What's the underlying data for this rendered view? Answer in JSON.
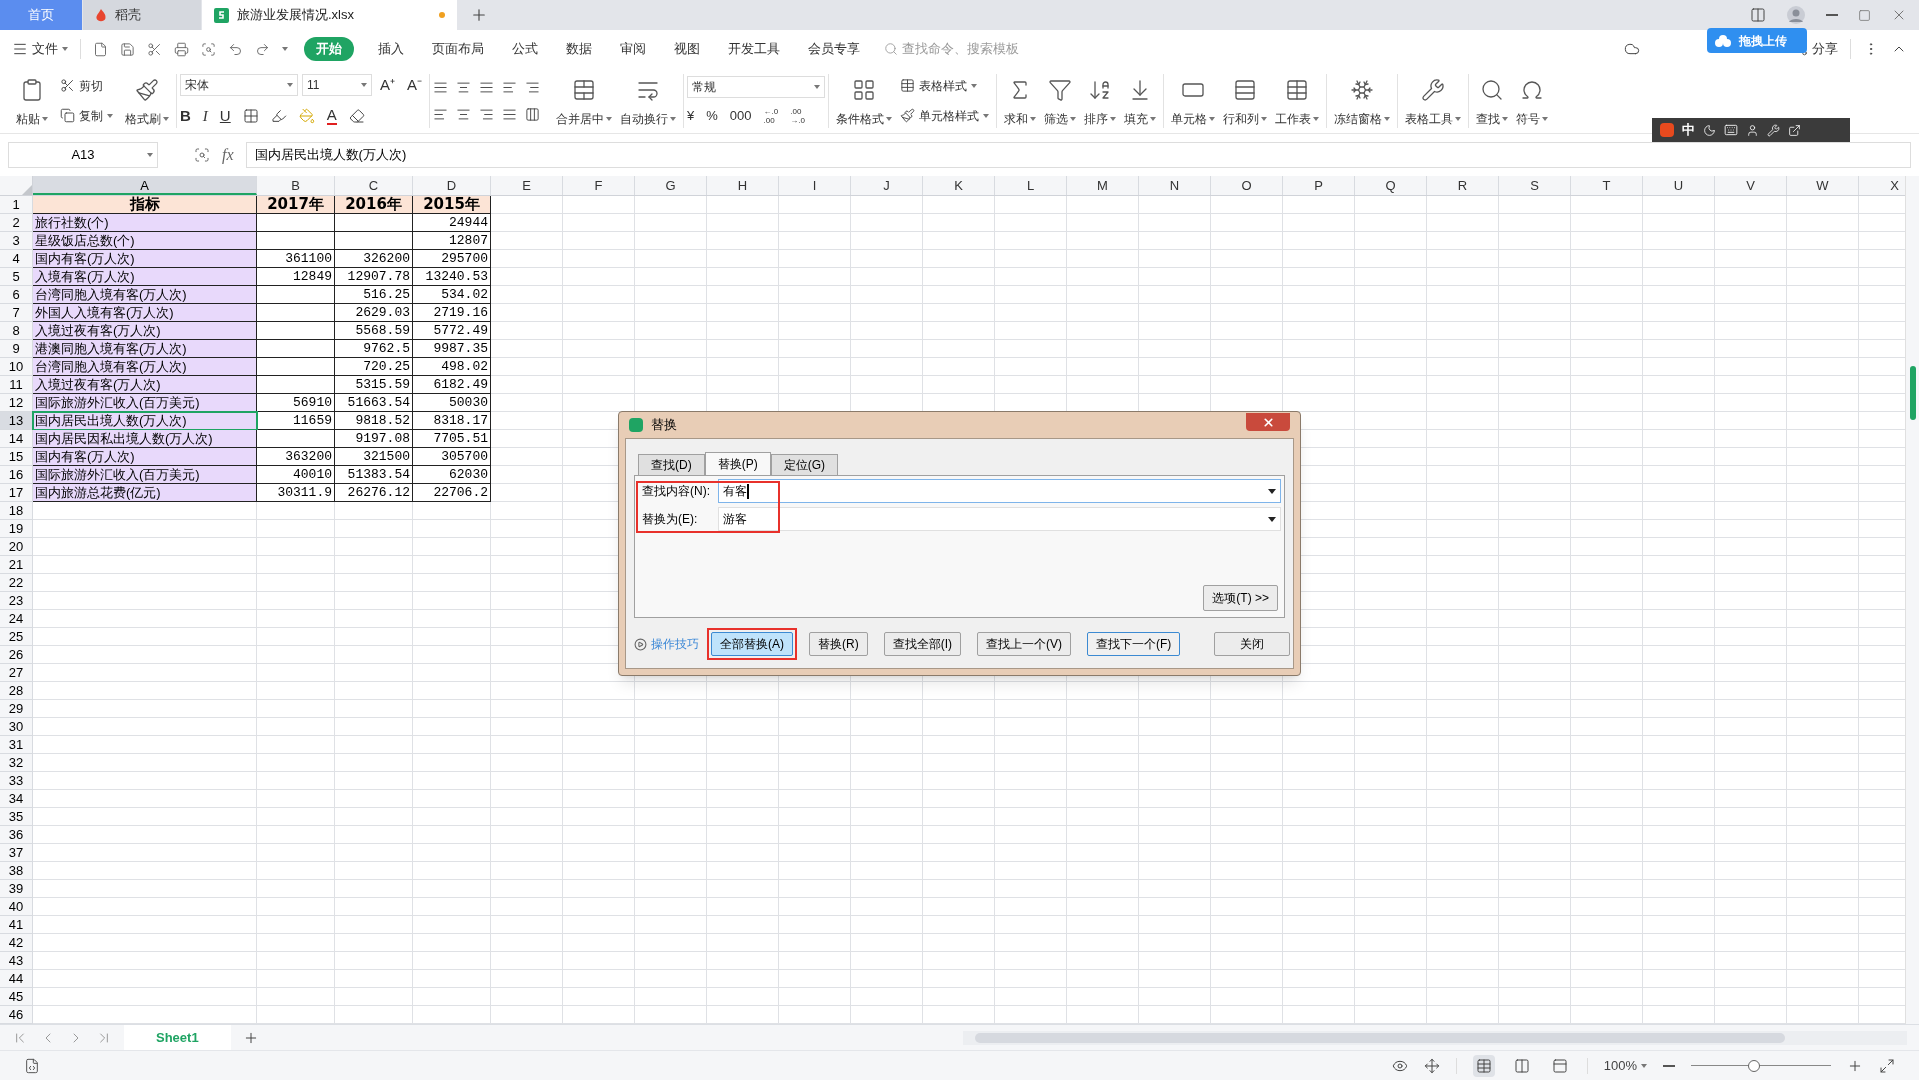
{
  "tabs": [
    {
      "label": "首页",
      "kind": "home",
      "selected": false,
      "unsaved": false
    },
    {
      "label": "稻壳",
      "kind": "docer",
      "selected": false,
      "unsaved": false
    },
    {
      "label": "旅游业发展情况.xlsx",
      "kind": "file",
      "selected": true,
      "unsaved": true
    }
  ],
  "menu": {
    "file": "文件",
    "items": [
      {
        "label": "开始",
        "selected": true
      },
      {
        "label": "插入",
        "selected": false
      },
      {
        "label": "页面布局",
        "selected": false
      },
      {
        "label": "公式",
        "selected": false
      },
      {
        "label": "数据",
        "selected": false
      },
      {
        "label": "审阅",
        "selected": false
      },
      {
        "label": "视图",
        "selected": false
      },
      {
        "label": "开发工具",
        "selected": false
      },
      {
        "label": "会员专享",
        "selected": false
      }
    ],
    "search": {
      "placeholder": "查找命令、搜索模板"
    },
    "share": "分享",
    "upload_popup": "拖拽上传"
  },
  "ribbon": {
    "clipboard": {
      "paste": "粘贴",
      "cut": "剪切",
      "copy": "复制",
      "format_painter": "格式刷"
    },
    "font": {
      "name": "宋体",
      "size": "11",
      "grow": "A⁺",
      "shrink": "A⁻",
      "styles": [
        "B",
        "I",
        "U"
      ],
      "font_color": "A"
    },
    "alignment": {
      "merge": "合并居中",
      "wrap": "自动换行"
    },
    "number": {
      "format": "常规",
      "symbols": [
        "¥",
        "%",
        "000"
      ],
      "decimals": [
        [
          "←.0",
          ".00"
        ],
        [
          ".00",
          "→.0"
        ]
      ]
    },
    "styles": {
      "conditional": "条件格式",
      "table_style": "表格样式",
      "cell_style": "单元格样式"
    },
    "tools": [
      "求和",
      "筛选",
      "排序",
      "填充",
      "单元格",
      "行和列",
      "工作表",
      "冻结窗格",
      "表格工具",
      "查找",
      "符号"
    ]
  },
  "ime": {
    "mode": "中"
  },
  "formula_bar": {
    "name_box": "A13",
    "fx": "fx",
    "formula": "国内居民出境人数(万人次)"
  },
  "sheet": {
    "columns": [
      {
        "label": "A",
        "selected": true
      },
      {
        "label": "B",
        "selected": false
      },
      {
        "label": "C",
        "selected": false
      },
      {
        "label": "D",
        "selected": false
      },
      {
        "label": "E",
        "selected": false
      },
      {
        "label": "F",
        "selected": false
      },
      {
        "label": "G",
        "selected": false
      },
      {
        "label": "H",
        "selected": false
      },
      {
        "label": "I",
        "selected": false
      },
      {
        "label": "J",
        "selected": false
      },
      {
        "label": "K",
        "selected": false
      },
      {
        "label": "L",
        "selected": false
      },
      {
        "label": "M",
        "selected": false
      },
      {
        "label": "N",
        "selected": false
      },
      {
        "label": "O",
        "selected": false
      },
      {
        "label": "P",
        "selected": false
      },
      {
        "label": "Q",
        "selected": false
      },
      {
        "label": "R",
        "selected": false
      },
      {
        "label": "S",
        "selected": false
      },
      {
        "label": "T",
        "selected": false
      },
      {
        "label": "U",
        "selected": false
      },
      {
        "label": "V",
        "selected": false
      },
      {
        "label": "W",
        "selected": false
      },
      {
        "label": "X",
        "selected": false
      }
    ],
    "rows": [
      {
        "number": "1",
        "kind": "header",
        "selected": false,
        "cells": [
          "指标",
          "2017年",
          "2016年",
          "2015年"
        ]
      },
      {
        "number": "2",
        "kind": "data",
        "selected": false,
        "cells": [
          "旅行社数(个)",
          "",
          "",
          "24944"
        ]
      },
      {
        "number": "3",
        "kind": "data",
        "selected": false,
        "cells": [
          "星级饭店总数(个)",
          "",
          "",
          "12807"
        ]
      },
      {
        "number": "4",
        "kind": "data",
        "selected": false,
        "cells": [
          "国内有客(万人次)",
          "361100",
          "326200",
          "295700"
        ]
      },
      {
        "number": "5",
        "kind": "data",
        "selected": false,
        "cells": [
          "入境有客(万人次)",
          "12849",
          "12907.78",
          "13240.53"
        ]
      },
      {
        "number": "6",
        "kind": "data",
        "selected": false,
        "cells": [
          "台湾同胞入境有客(万人次)",
          "",
          "516.25",
          "534.02"
        ]
      },
      {
        "number": "7",
        "kind": "data",
        "selected": false,
        "cells": [
          "外国人入境有客(万人次)",
          "",
          "2629.03",
          "2719.16"
        ]
      },
      {
        "number": "8",
        "kind": "data",
        "selected": false,
        "cells": [
          "入境过夜有客(万人次)",
          "",
          "5568.59",
          "5772.49"
        ]
      },
      {
        "number": "9",
        "kind": "data",
        "selected": false,
        "cells": [
          "港澳同胞入境有客(万人次)",
          "",
          "9762.5",
          "9987.35"
        ]
      },
      {
        "number": "10",
        "kind": "data",
        "selected": false,
        "cells": [
          "台湾同胞入境有客(万人次)",
          "",
          "720.25",
          "498.02"
        ]
      },
      {
        "number": "11",
        "kind": "data",
        "selected": false,
        "cells": [
          "入境过夜有客(万人次)",
          "",
          "5315.59",
          "6182.49"
        ]
      },
      {
        "number": "12",
        "kind": "data",
        "selected": false,
        "cells": [
          "国际旅游外汇收入(百万美元)",
          "56910",
          "51663.54",
          "50030"
        ]
      },
      {
        "number": "13",
        "kind": "data",
        "selected": true,
        "cells": [
          "国内居民出境人数(万人次)",
          "11659",
          "9818.52",
          "8318.17"
        ]
      },
      {
        "number": "14",
        "kind": "data",
        "selected": false,
        "cells": [
          "国内居民因私出境人数(万人次)",
          "",
          "9197.08",
          "7705.51"
        ]
      },
      {
        "number": "15",
        "kind": "data",
        "selected": false,
        "cells": [
          "国内有客(万人次)",
          "363200",
          "321500",
          "305700"
        ]
      },
      {
        "number": "16",
        "kind": "data",
        "selected": false,
        "cells": [
          "国际旅游外汇收入(百万美元)",
          "40010",
          "51383.54",
          "62030"
        ]
      },
      {
        "number": "17",
        "kind": "data",
        "selected": false,
        "cells": [
          "国内旅游总花费(亿元)",
          "30311.9",
          "26276.12",
          "22706.2"
        ]
      },
      {
        "number": "18",
        "kind": "empty",
        "selected": false
      },
      {
        "number": "19",
        "kind": "empty",
        "selected": false
      },
      {
        "number": "20",
        "kind": "empty",
        "selected": false
      },
      {
        "number": "21",
        "kind": "empty",
        "selected": false
      },
      {
        "number": "22",
        "kind": "empty",
        "selected": false
      },
      {
        "number": "23",
        "kind": "empty",
        "selected": false
      },
      {
        "number": "24",
        "kind": "empty",
        "selected": false
      },
      {
        "number": "25",
        "kind": "empty",
        "selected": false
      },
      {
        "number": "26",
        "kind": "empty",
        "selected": false
      },
      {
        "number": "27",
        "kind": "empty",
        "selected": false
      },
      {
        "number": "28",
        "kind": "empty",
        "selected": false
      },
      {
        "number": "29",
        "kind": "empty",
        "selected": false
      },
      {
        "number": "30",
        "kind": "empty",
        "selected": false
      },
      {
        "number": "31",
        "kind": "empty",
        "selected": false
      },
      {
        "number": "32",
        "kind": "empty",
        "selected": false
      },
      {
        "number": "33",
        "kind": "empty",
        "selected": false
      },
      {
        "number": "34",
        "kind": "empty",
        "selected": false
      },
      {
        "number": "35",
        "kind": "empty",
        "selected": false
      },
      {
        "number": "36",
        "kind": "empty",
        "selected": false
      },
      {
        "number": "37",
        "kind": "empty",
        "selected": false
      },
      {
        "number": "38",
        "kind": "empty",
        "selected": false
      },
      {
        "number": "39",
        "kind": "empty",
        "selected": false
      },
      {
        "number": "40",
        "kind": "empty",
        "selected": false
      },
      {
        "number": "41",
        "kind": "empty",
        "selected": false
      },
      {
        "number": "42",
        "kind": "empty",
        "selected": false
      },
      {
        "number": "43",
        "kind": "empty",
        "selected": false
      },
      {
        "number": "44",
        "kind": "empty",
        "selected": false
      },
      {
        "number": "45",
        "kind": "empty",
        "selected": false
      },
      {
        "number": "46",
        "kind": "empty",
        "selected": false
      }
    ]
  },
  "sheet_tabs": [
    {
      "label": "Sheet1",
      "selected": true
    }
  ],
  "status_bar": {
    "views": [
      {
        "selected": true
      },
      {
        "selected": false
      },
      {
        "selected": false
      }
    ],
    "zoom": "100%",
    "zoom_slider": {
      "level": 0.45
    }
  },
  "dialog": {
    "title": "替换",
    "tabs": [
      {
        "label": "查找(D)",
        "selected": false
      },
      {
        "label": "替换(P)",
        "selected": true
      },
      {
        "label": "定位(G)",
        "selected": false
      }
    ],
    "fields_highlighted": true,
    "fields": [
      {
        "label": "查找内容(N):",
        "value": "有客",
        "focused": true
      },
      {
        "label": "替换为(E):",
        "value": "游客",
        "focused": false
      }
    ],
    "options_button": "选项(T) >>",
    "tips_link": "操作技巧",
    "buttons": [
      {
        "label": "全部替换(A)",
        "kind": "pressed",
        "highlighted": true
      },
      {
        "label": "替换(R)",
        "kind": "normal",
        "highlighted": false
      },
      {
        "label": "查找全部(I)",
        "kind": "normal",
        "highlighted": false
      },
      {
        "label": "查找上一个(V)",
        "kind": "normal",
        "highlighted": false
      },
      {
        "label": "查找下一个(F)",
        "kind": "focused",
        "highlighted": false
      },
      {
        "label": "关闭",
        "kind": "normal",
        "highlighted": false
      }
    ]
  }
}
